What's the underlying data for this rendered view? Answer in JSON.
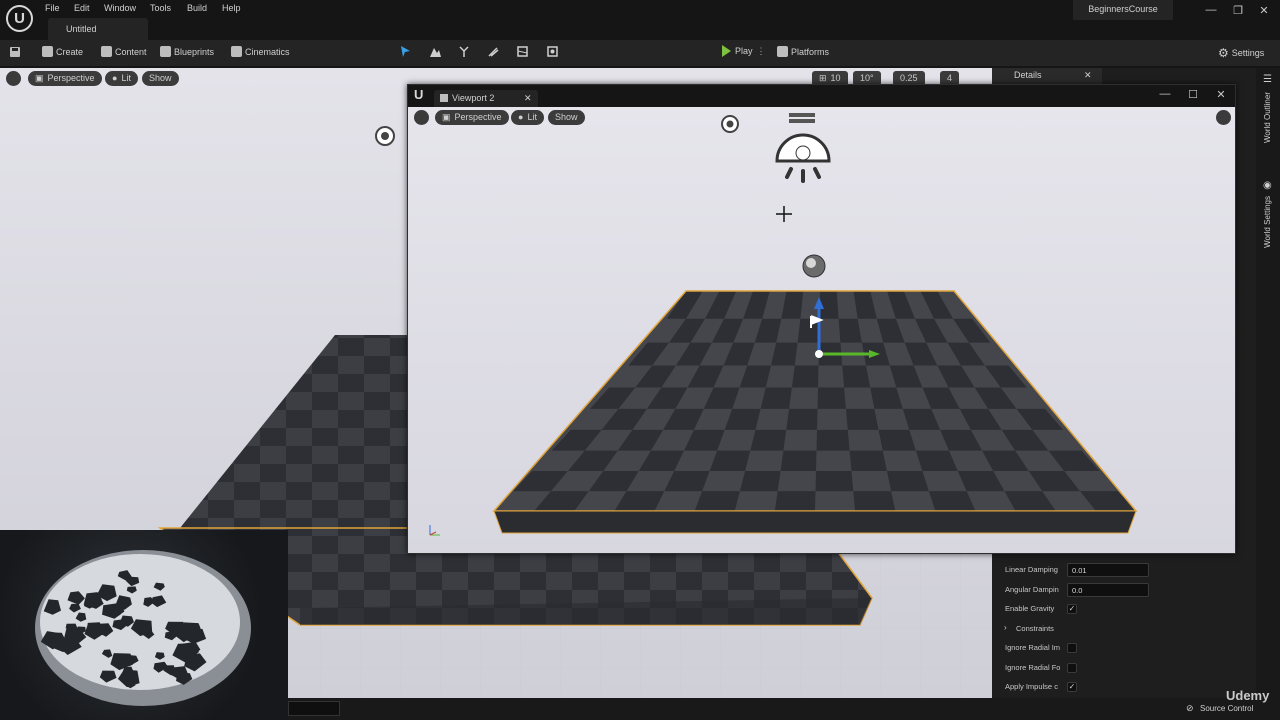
{
  "menubar": {
    "logo": "U",
    "items": [
      "File",
      "Edit",
      "Window",
      "Tools",
      "Build",
      "Help"
    ],
    "doc_tab": "Untitled",
    "project": "BeginnersCourse",
    "win_controls": [
      "—",
      "❐",
      "✕"
    ]
  },
  "toolbar": {
    "create": "Create",
    "content": "Content",
    "blueprints": "Blueprints",
    "cinematics": "Cinematics",
    "play": "Play",
    "platforms": "Platforms",
    "settings": "Settings"
  },
  "viewport": {
    "perspective": "Perspective",
    "lit": "Lit",
    "show": "Show",
    "grid_value": "10",
    "rot_value": "10°",
    "scale_value": "0.25",
    "cam_speed": "4"
  },
  "viewport2": {
    "tab": "Viewport 2",
    "close": "✕",
    "perspective": "Perspective",
    "lit": "Lit",
    "show": "Show",
    "win_controls": [
      "—",
      "☐",
      "✕"
    ]
  },
  "details": {
    "tab": "Details",
    "close": "✕",
    "properties": [
      {
        "label": "Linear Damping",
        "value": "0.01",
        "kind": "input"
      },
      {
        "label": "Angular Dampin",
        "value": "0.0",
        "kind": "input"
      },
      {
        "label": "Enable Gravity",
        "value": "✓",
        "kind": "check"
      },
      {
        "label": "Constraints",
        "value": "",
        "kind": "section"
      },
      {
        "label": "Ignore Radial Im",
        "value": "",
        "kind": "check"
      },
      {
        "label": "Ignore Radial Fo",
        "value": "",
        "kind": "check"
      },
      {
        "label": "Apply Impulse c",
        "value": "✓",
        "kind": "check"
      }
    ]
  },
  "side": {
    "world_outliner": "World Outliner",
    "world_settings": "World Settings"
  },
  "status": {
    "source_control": "Source Control",
    "watermark": "Udemy"
  }
}
